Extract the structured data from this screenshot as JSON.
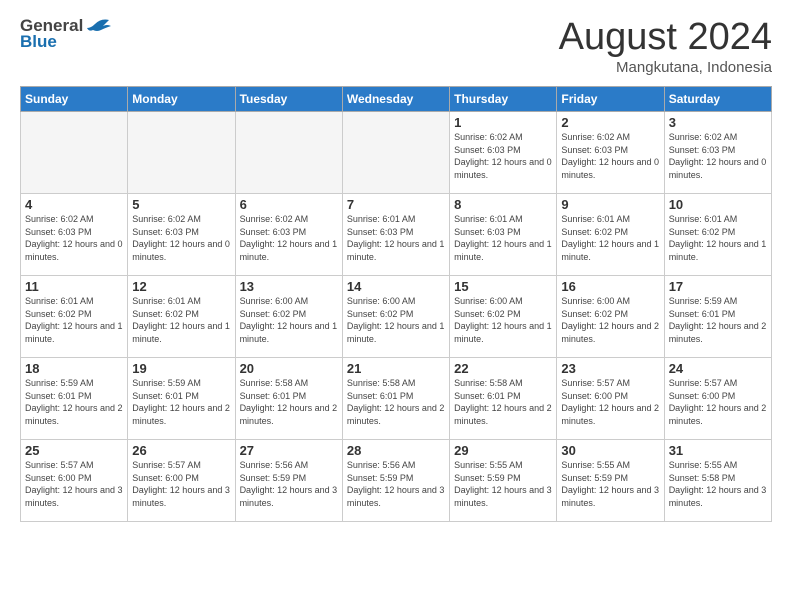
{
  "header": {
    "logo_general": "General",
    "logo_blue": "Blue",
    "month": "August 2024",
    "location": "Mangkutana, Indonesia"
  },
  "days_of_week": [
    "Sunday",
    "Monday",
    "Tuesday",
    "Wednesday",
    "Thursday",
    "Friday",
    "Saturday"
  ],
  "weeks": [
    [
      {
        "day": "",
        "empty": true
      },
      {
        "day": "",
        "empty": true
      },
      {
        "day": "",
        "empty": true
      },
      {
        "day": "",
        "empty": true
      },
      {
        "day": "1",
        "sunrise": "6:02 AM",
        "sunset": "6:03 PM",
        "daylight": "12 hours and 0 minutes."
      },
      {
        "day": "2",
        "sunrise": "6:02 AM",
        "sunset": "6:03 PM",
        "daylight": "12 hours and 0 minutes."
      },
      {
        "day": "3",
        "sunrise": "6:02 AM",
        "sunset": "6:03 PM",
        "daylight": "12 hours and 0 minutes."
      }
    ],
    [
      {
        "day": "4",
        "sunrise": "6:02 AM",
        "sunset": "6:03 PM",
        "daylight": "12 hours and 0 minutes."
      },
      {
        "day": "5",
        "sunrise": "6:02 AM",
        "sunset": "6:03 PM",
        "daylight": "12 hours and 0 minutes."
      },
      {
        "day": "6",
        "sunrise": "6:02 AM",
        "sunset": "6:03 PM",
        "daylight": "12 hours and 1 minute."
      },
      {
        "day": "7",
        "sunrise": "6:01 AM",
        "sunset": "6:03 PM",
        "daylight": "12 hours and 1 minute."
      },
      {
        "day": "8",
        "sunrise": "6:01 AM",
        "sunset": "6:03 PM",
        "daylight": "12 hours and 1 minute."
      },
      {
        "day": "9",
        "sunrise": "6:01 AM",
        "sunset": "6:02 PM",
        "daylight": "12 hours and 1 minute."
      },
      {
        "day": "10",
        "sunrise": "6:01 AM",
        "sunset": "6:02 PM",
        "daylight": "12 hours and 1 minute."
      }
    ],
    [
      {
        "day": "11",
        "sunrise": "6:01 AM",
        "sunset": "6:02 PM",
        "daylight": "12 hours and 1 minute."
      },
      {
        "day": "12",
        "sunrise": "6:01 AM",
        "sunset": "6:02 PM",
        "daylight": "12 hours and 1 minute."
      },
      {
        "day": "13",
        "sunrise": "6:00 AM",
        "sunset": "6:02 PM",
        "daylight": "12 hours and 1 minute."
      },
      {
        "day": "14",
        "sunrise": "6:00 AM",
        "sunset": "6:02 PM",
        "daylight": "12 hours and 1 minute."
      },
      {
        "day": "15",
        "sunrise": "6:00 AM",
        "sunset": "6:02 PM",
        "daylight": "12 hours and 1 minute."
      },
      {
        "day": "16",
        "sunrise": "6:00 AM",
        "sunset": "6:02 PM",
        "daylight": "12 hours and 2 minutes."
      },
      {
        "day": "17",
        "sunrise": "5:59 AM",
        "sunset": "6:01 PM",
        "daylight": "12 hours and 2 minutes."
      }
    ],
    [
      {
        "day": "18",
        "sunrise": "5:59 AM",
        "sunset": "6:01 PM",
        "daylight": "12 hours and 2 minutes."
      },
      {
        "day": "19",
        "sunrise": "5:59 AM",
        "sunset": "6:01 PM",
        "daylight": "12 hours and 2 minutes."
      },
      {
        "day": "20",
        "sunrise": "5:58 AM",
        "sunset": "6:01 PM",
        "daylight": "12 hours and 2 minutes."
      },
      {
        "day": "21",
        "sunrise": "5:58 AM",
        "sunset": "6:01 PM",
        "daylight": "12 hours and 2 minutes."
      },
      {
        "day": "22",
        "sunrise": "5:58 AM",
        "sunset": "6:01 PM",
        "daylight": "12 hours and 2 minutes."
      },
      {
        "day": "23",
        "sunrise": "5:57 AM",
        "sunset": "6:00 PM",
        "daylight": "12 hours and 2 minutes."
      },
      {
        "day": "24",
        "sunrise": "5:57 AM",
        "sunset": "6:00 PM",
        "daylight": "12 hours and 2 minutes."
      }
    ],
    [
      {
        "day": "25",
        "sunrise": "5:57 AM",
        "sunset": "6:00 PM",
        "daylight": "12 hours and 3 minutes."
      },
      {
        "day": "26",
        "sunrise": "5:57 AM",
        "sunset": "6:00 PM",
        "daylight": "12 hours and 3 minutes."
      },
      {
        "day": "27",
        "sunrise": "5:56 AM",
        "sunset": "5:59 PM",
        "daylight": "12 hours and 3 minutes."
      },
      {
        "day": "28",
        "sunrise": "5:56 AM",
        "sunset": "5:59 PM",
        "daylight": "12 hours and 3 minutes."
      },
      {
        "day": "29",
        "sunrise": "5:55 AM",
        "sunset": "5:59 PM",
        "daylight": "12 hours and 3 minutes."
      },
      {
        "day": "30",
        "sunrise": "5:55 AM",
        "sunset": "5:59 PM",
        "daylight": "12 hours and 3 minutes."
      },
      {
        "day": "31",
        "sunrise": "5:55 AM",
        "sunset": "5:58 PM",
        "daylight": "12 hours and 3 minutes."
      }
    ]
  ]
}
